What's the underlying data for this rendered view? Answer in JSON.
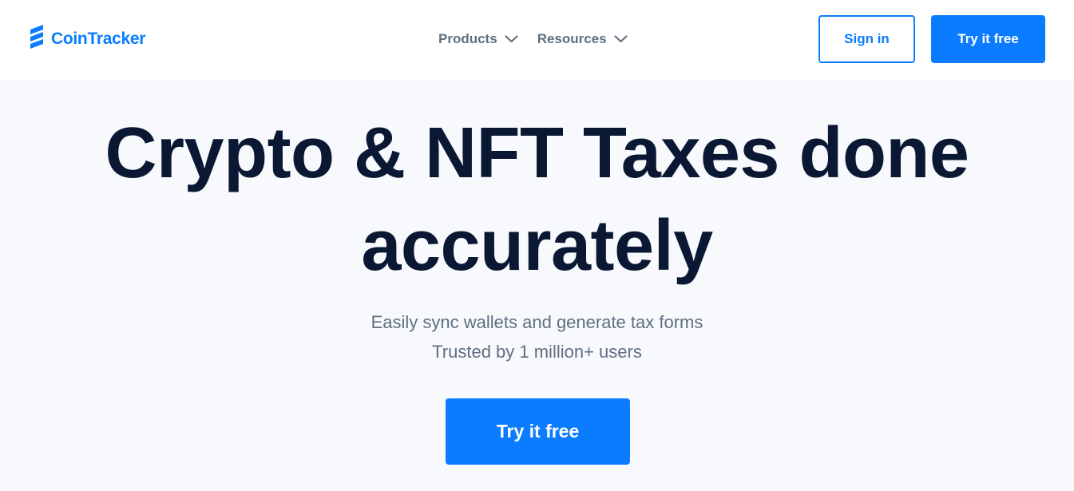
{
  "brand": {
    "name": "CoinTracker",
    "icon": "cointracker-logo-icon",
    "color": "#0b7cff"
  },
  "nav": {
    "items": [
      {
        "label": "Products",
        "icon": "chevron-down-icon"
      },
      {
        "label": "Resources",
        "icon": "chevron-down-icon"
      }
    ]
  },
  "header": {
    "signin_label": "Sign in",
    "try_label": "Try it free"
  },
  "hero": {
    "title_line1": "Crypto & NFT Taxes done",
    "title_line2": "accurately",
    "subtitle_line1": "Easily sync wallets and generate tax forms",
    "subtitle_line2": "Trusted by 1 million+ users",
    "cta_label": "Try it free"
  },
  "colors": {
    "accent": "#0b7cff",
    "heading": "#0b1833",
    "muted": "#5f6f81",
    "background": "#f7f9fc"
  }
}
